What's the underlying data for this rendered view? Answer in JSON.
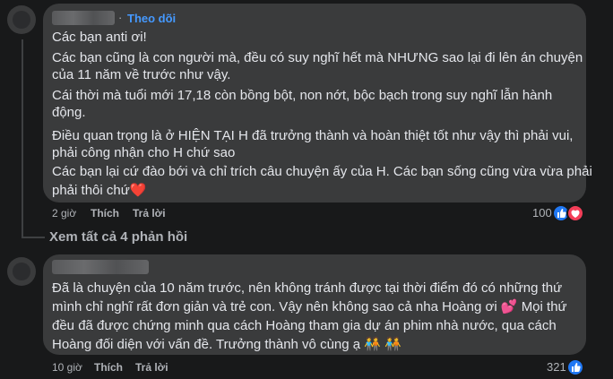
{
  "comment1": {
    "author_label": "",
    "follow_label": "Theo dõi",
    "lines": [
      "Các bạn anti ơi!",
      "Các bạn cũng là con người mà, đều có suy nghĩ hết mà NHƯNG sao lại đi lên án chuyện",
      "của 11 năm về trước như vậy.",
      "Cái thời mà tuổi mới 17,18 còn bồng bột, non nớt, bộc bạch trong suy nghĩ lẫn hành",
      "động.",
      "Điều quan trọng là ở HIỆN TẠI H đã trưởng thành và hoàn thiệt tốt như vậy thì phải vui,",
      "phải công nhận cho H chứ sao",
      "Các bạn lại cứ đào bới và chỉ trích câu chuyện ấy của H. Các bạn sống cũng vừa vừa phải",
      "phải thôi chứ"
    ],
    "trailing_emoji": "❤️",
    "time": "2 giờ",
    "like_label": "Thích",
    "reply_label": "Trả lời",
    "reaction_count": "100"
  },
  "see_all_replies": "Xem tất cả 4 phản hồi",
  "comment2": {
    "author_label": "",
    "lines": [
      "Đã là chuyện của 10 năm trước, nên không tránh được tại thời điểm đó có những thứ",
      "mình chỉ nghĩ rất đơn giản và trẻ con. Vậy nên không sao cả nha Hoàng ơi",
      "đều đã được chứng minh qua cách Hoàng tham gia dự án phim nhà nước, qua cách",
      "Hoàng đối diện với vấn đề. Trưởng thành vô cùng ạ"
    ],
    "line2_emoji": "💕",
    "line2_tail": "Mọi thứ",
    "line4_emoji": "🧑‍🤝‍🧑 🧑‍🤝‍🧑",
    "time": "10 giờ",
    "like_label": "Thích",
    "reply_label": "Trả lời",
    "reaction_count": "321"
  },
  "colors": {
    "background": "#18191a",
    "bubble": "#3a3b3c",
    "follow": "#4599ff",
    "like_blue": "#2078f4",
    "love_red": "#f33e58"
  },
  "icons": {
    "like": "thumbs-up-icon",
    "love": "heart-icon"
  }
}
